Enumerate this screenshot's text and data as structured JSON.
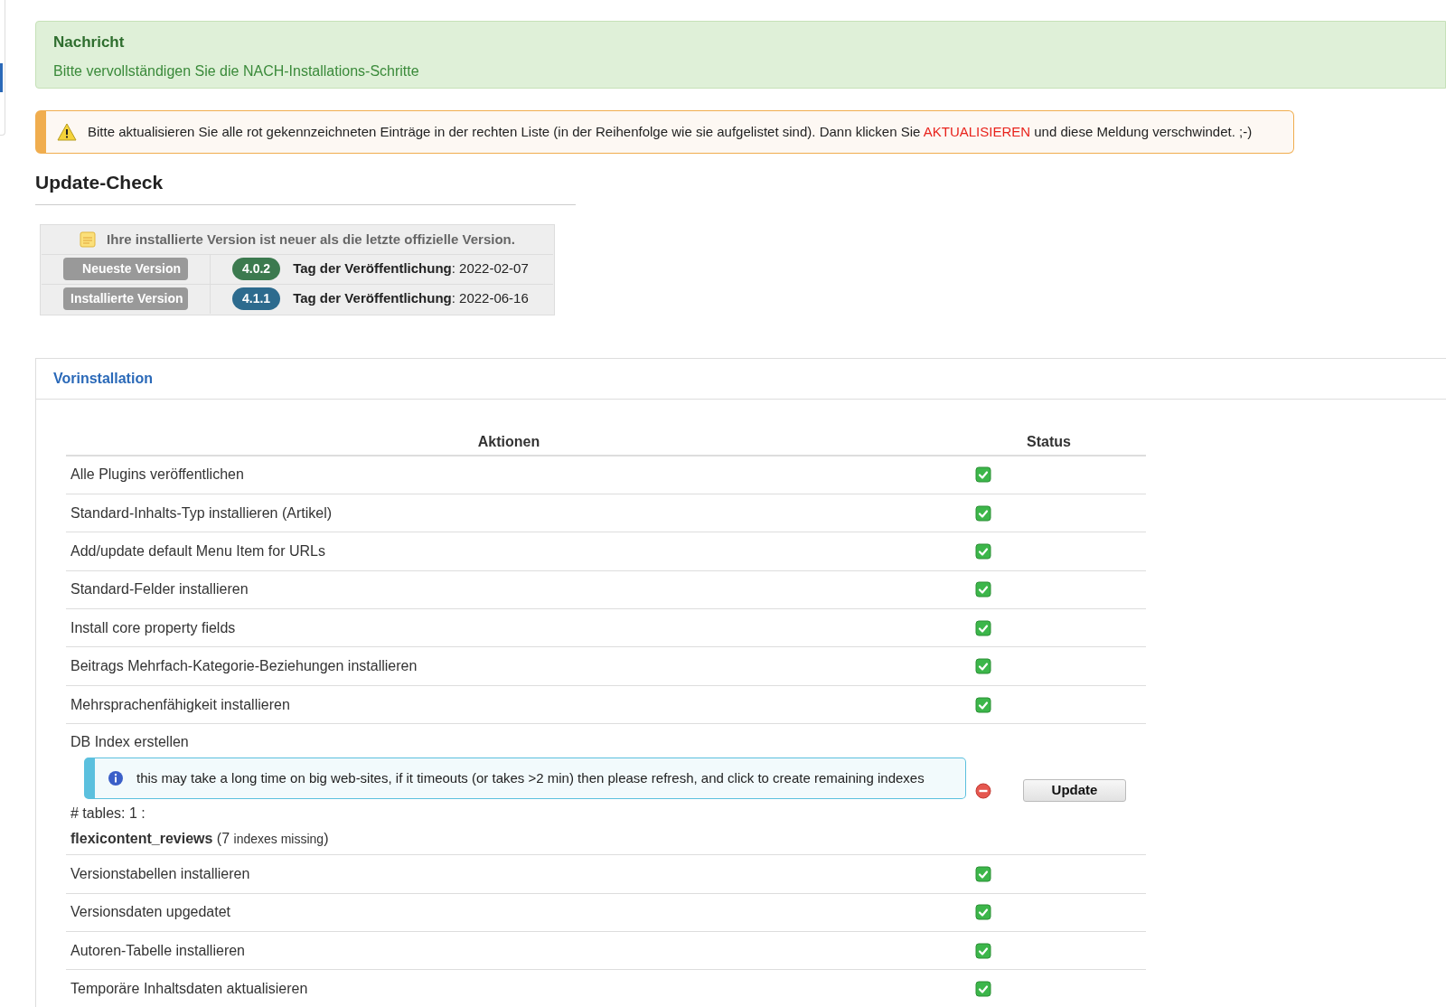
{
  "message": {
    "title": "Nachricht",
    "text": "Bitte vervollständigen Sie die NACH-Installations-Schritte"
  },
  "warning": {
    "before": "Bitte aktualisieren Sie alle rot gekennzeichneten Einträge in der rechten Liste (in der Reihenfolge wie sie aufgelistet sind). Dann klicken Sie",
    "link": "AKTUALISIEREN",
    "after": "und diese Meldung verschwindet. ;-)"
  },
  "update_check": {
    "title": "Update-Check",
    "notice": "Ihre installierte Version ist neuer als die letzte offizielle Version.",
    "rows": [
      {
        "label": "Neueste Version",
        "version": "4.0.2",
        "color": "#3c7a4f",
        "date_label": "Tag der Veröffentlichung",
        "separator": ":",
        "date": "2022-02-07"
      },
      {
        "label": "Installierte Version",
        "version": "4.1.1",
        "color": "#2d6b8e",
        "date_label": "Tag der Veröffentlichung",
        "separator": ":",
        "date": "2022-06-16"
      }
    ]
  },
  "panel": {
    "title": "Vorinstallation",
    "columns": [
      "Aktionen",
      "Status"
    ],
    "rows": [
      {
        "kind": "simple",
        "action": "Alle Plugins veröffentlichen",
        "done": true
      },
      {
        "kind": "simple",
        "action": "Standard-Inhalts-Typ installieren (Artikel)",
        "done": true
      },
      {
        "kind": "simple",
        "action": "Add/update default Menu Item for URLs",
        "done": true
      },
      {
        "kind": "simple",
        "action": "Standard-Felder installieren",
        "done": true
      },
      {
        "kind": "simple",
        "action": "Install core property fields",
        "done": true
      },
      {
        "kind": "simple",
        "action": "Beitrags Mehrfach-Kategorie-Beziehungen installieren",
        "done": true
      },
      {
        "kind": "simple",
        "action": "Mehrsprachenfähigkeit installieren",
        "done": true
      },
      {
        "kind": "detail",
        "action": "DB Index erstellen",
        "done": false,
        "info": "this may take a long time on big web-sites, if it timeouts (or takes >2 min) then please refresh, and click to create remaining indexes",
        "tables": "# tables: 1 :",
        "table_name": "flexicontent_reviews",
        "missing_open": "(7",
        "missing_small": "indexes missing",
        "missing_close": ")",
        "button": "Update"
      },
      {
        "kind": "simple",
        "action": "Versionstabellen installieren",
        "done": true
      },
      {
        "kind": "simple",
        "action": "Versionsdaten upgedatet",
        "done": true
      },
      {
        "kind": "simple",
        "action": "Autoren-Tabelle installieren",
        "done": true
      },
      {
        "kind": "simple",
        "action": "Temporäre Inhaltsdaten aktualisieren",
        "done": true
      }
    ]
  }
}
